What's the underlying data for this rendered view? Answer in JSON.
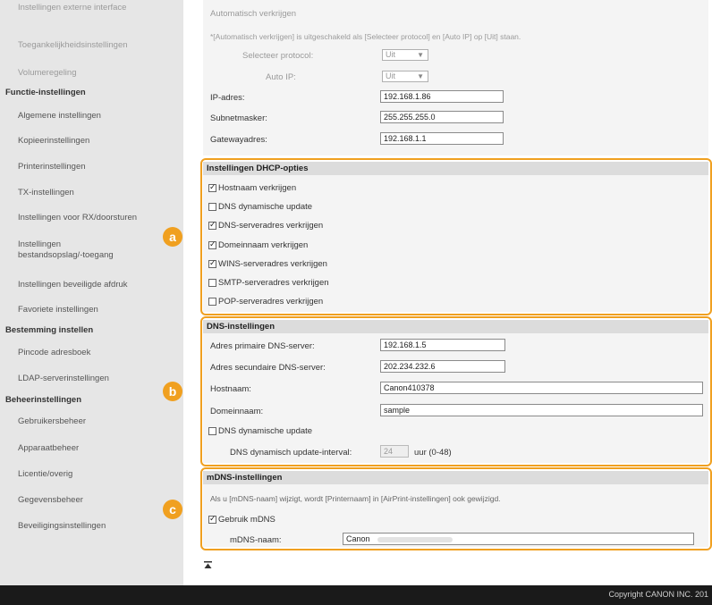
{
  "sidebar": {
    "items_top": [
      {
        "label": "Instellingen externe interface",
        "faded": true
      },
      {
        "label": "Toegankelijkheidsinstellingen",
        "faded": true
      },
      {
        "label": "Volumeregeling",
        "faded": true
      }
    ],
    "group1": {
      "heading": "Functie-instellingen",
      "items": [
        "Algemene instellingen",
        "Kopieerinstellingen",
        "Printerinstellingen",
        "TX-instellingen",
        "Instellingen voor RX/doorsturen",
        "Instellingen\nbestandsopslag/-toegang",
        "Instellingen beveiligde afdruk",
        "Favoriete instellingen"
      ]
    },
    "group2": {
      "heading": "Bestemming instellen",
      "items": [
        "Pincode adresboek",
        "LDAP-serverinstellingen"
      ]
    },
    "group3": {
      "heading": "Beheerinstellingen",
      "items": [
        "Gebruikersbeheer",
        "Apparaatbeheer",
        "Licentie/overig",
        "Gegevensbeheer",
        "Beveiligingsinstellingen"
      ]
    }
  },
  "top": {
    "title": "Automatisch verkrijgen",
    "note": "*[Automatisch verkrijgen] is uitgeschakeld als [Selecteer protocol] en [Auto IP] op [Uit] staan.",
    "protocol_label": "Selecteer protocol:",
    "protocol_value": "Uit",
    "autoip_label": "Auto IP:",
    "autoip_value": "Uit",
    "ip_label": "IP-adres:",
    "ip_value": "192.168.1.86",
    "subnet_label": "Subnetmasker:",
    "subnet_value": "255.255.255.0",
    "gateway_label": "Gatewayadres:",
    "gateway_value": "192.168.1.1"
  },
  "dhcp": {
    "badge": "a",
    "heading": "Instellingen DHCP-opties",
    "options": [
      {
        "label": "Hostnaam verkrijgen",
        "checked": true
      },
      {
        "label": "DNS dynamische update",
        "checked": false
      },
      {
        "label": "DNS-serveradres verkrijgen",
        "checked": true
      },
      {
        "label": "Domeinnaam verkrijgen",
        "checked": true
      },
      {
        "label": "WINS-serveradres verkrijgen",
        "checked": true
      },
      {
        "label": "SMTP-serveradres verkrijgen",
        "checked": false
      },
      {
        "label": "POP-serveradres verkrijgen",
        "checked": false
      }
    ]
  },
  "dns": {
    "badge": "b",
    "heading": "DNS-instellingen",
    "primary_label": "Adres primaire DNS-server:",
    "primary_value": "192.168.1.5",
    "secondary_label": "Adres secundaire DNS-server:",
    "secondary_value": "202.234.232.6",
    "hostname_label": "Hostnaam:",
    "hostname_value": "Canon410378",
    "domain_label": "Domeinnaam:",
    "domain_value": "sample",
    "dyn_label": "DNS dynamische update",
    "dyn_checked": false,
    "interval_label": "DNS dynamisch update-interval:",
    "interval_value": "24",
    "interval_unit": "uur (0-48)"
  },
  "mdns": {
    "badge": "c",
    "heading": "mDNS-instellingen",
    "note": "Als u [mDNS-naam] wijzigt, wordt [Printernaam] in [AirPrint-instellingen] ook gewijzigd.",
    "use_label": "Gebruik mDNS",
    "use_checked": true,
    "name_label": "mDNS-naam:",
    "name_value": "Canon"
  },
  "footer": {
    "copyright": "Copyright CANON INC. 201"
  },
  "colors": {
    "accent": "#f0a020",
    "sidebar_bg": "#e6e6e6",
    "panel_bg": "#f4f4f4"
  }
}
